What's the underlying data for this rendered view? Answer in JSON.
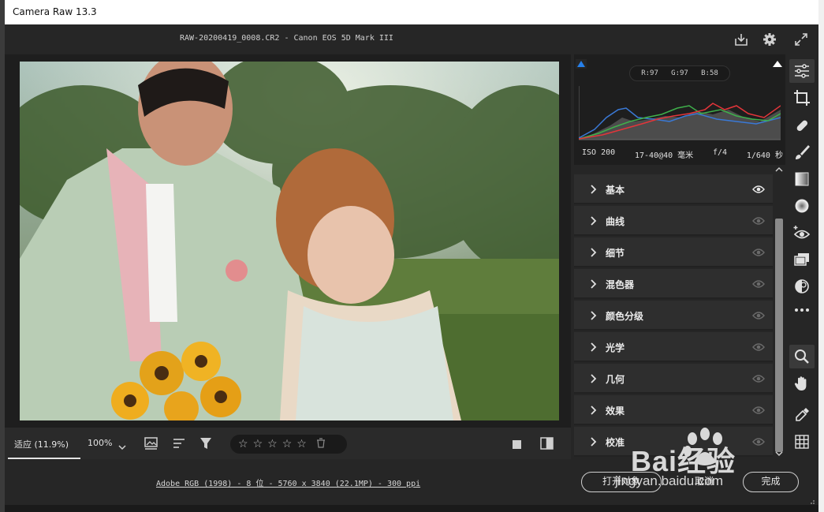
{
  "window": {
    "title": "Camera Raw 13.3"
  },
  "header": {
    "filename": "RAW-20200419_0008.CR2 -  Canon EOS 5D Mark III"
  },
  "histogram": {
    "r": "R:97",
    "g": "G:97",
    "b": "B:58",
    "iso": "ISO 200",
    "lens": "17-40@40 毫米",
    "aperture": "f/4",
    "shutter": "1/640 秒"
  },
  "panels": [
    {
      "label": "基本"
    },
    {
      "label": "曲线"
    },
    {
      "label": "细节"
    },
    {
      "label": "混色器"
    },
    {
      "label": "颜色分级"
    },
    {
      "label": "光学"
    },
    {
      "label": "几何"
    },
    {
      "label": "效果"
    },
    {
      "label": "校准"
    }
  ],
  "filmstrip": {
    "zoom_fit": "适应 (11.9%)",
    "zoom_pct": "100%"
  },
  "footer": {
    "info": "Adobe RGB (1998) - 8 位 - 5760 x 3840 (22.1MP) - 300 ppi",
    "open_label": "打开对象",
    "cancel_label": "取消",
    "done_label": "完成"
  },
  "watermark": {
    "text": "Bai经验",
    "url": "jingyan.baidu.com"
  },
  "colors": {
    "accent": "#2680eb",
    "panel": "#2e2e2e",
    "bg": "#262626"
  }
}
